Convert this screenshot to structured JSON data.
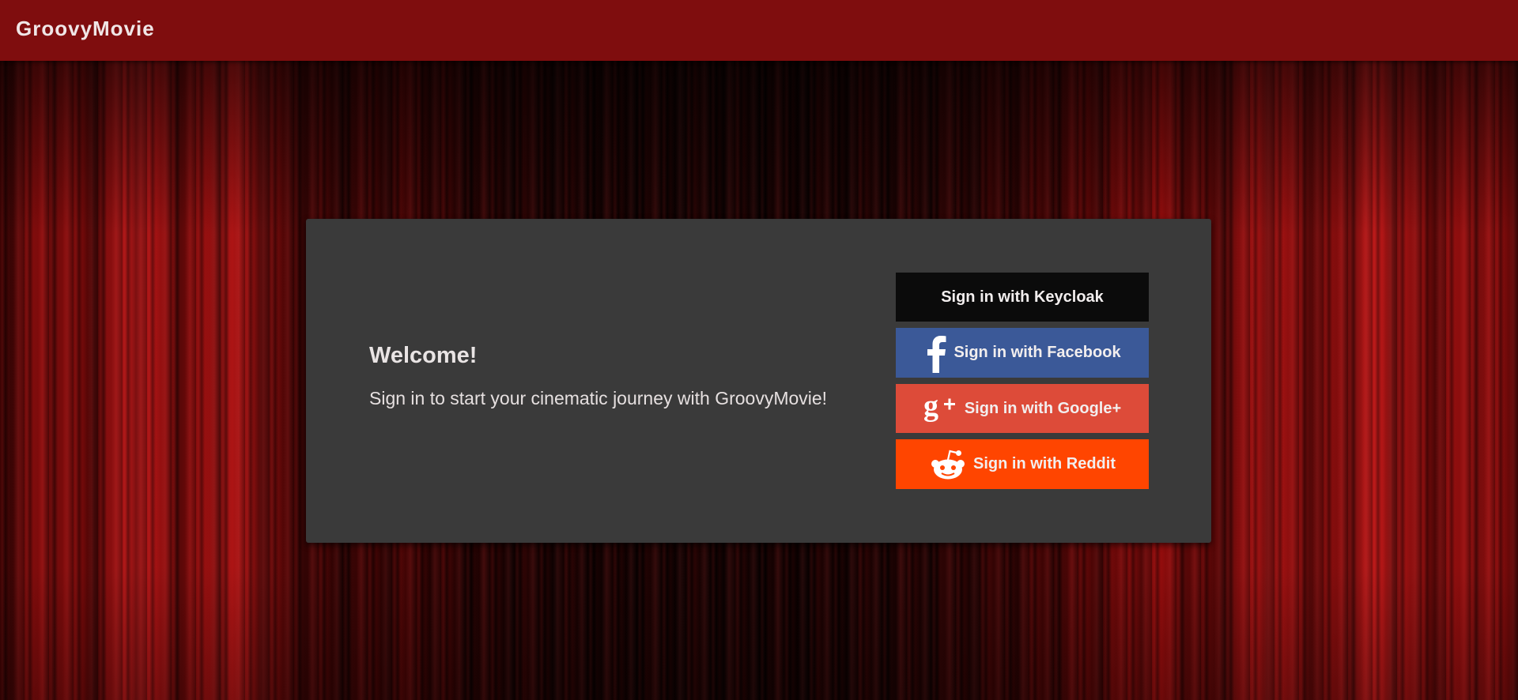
{
  "app": {
    "title": "GroovyMovie"
  },
  "card": {
    "welcome_title": "Welcome!",
    "welcome_subtitle": "Sign in to start your cinematic journey with GroovyMovie!"
  },
  "sign_in_buttons": [
    {
      "label": "Sign in with Keycloak",
      "icon": null,
      "color": "#0b0b0b"
    },
    {
      "label": "Sign in with Facebook",
      "icon": "facebook-icon",
      "color": "#3b5998"
    },
    {
      "label": "Sign in with Google+",
      "icon": "google-plus-icon",
      "color": "#dd4b39"
    },
    {
      "label": "Sign in with Reddit",
      "icon": "reddit-icon",
      "color": "#ff4500"
    }
  ],
  "theme": {
    "toolbar_color": "#7f0d0e",
    "card_color": "#3a3a3a",
    "background": "red theater curtain"
  }
}
